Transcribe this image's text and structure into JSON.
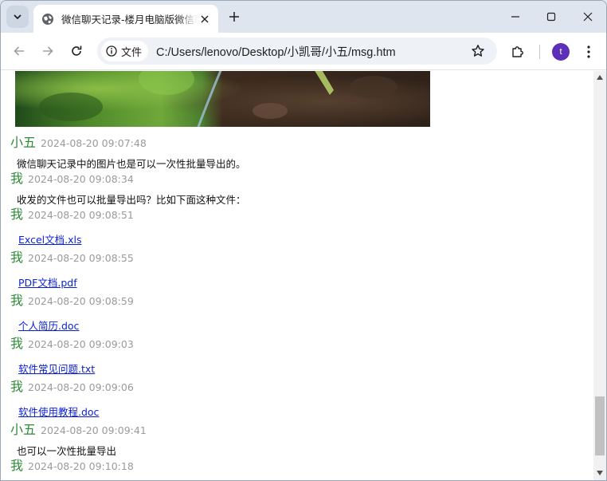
{
  "browser": {
    "tab_title": "微信聊天记录-楼月电脑版微信聊天记录导出",
    "address_chip_label": "文件",
    "url": "C:/Users/lenovo/Desktop/小凯哥/小五/msg.htm",
    "profile_initial": "t",
    "accent_color": "#5b2fb8"
  },
  "icons": {
    "tab_search": "chevron-down-icon",
    "favicon": "globe-icon",
    "tab_close": "close-icon",
    "new_tab": "plus-icon",
    "minimize": "minimize-icon",
    "maximize": "maximize-icon",
    "close_window": "close-icon",
    "back": "arrow-left-icon",
    "forward": "arrow-right-icon",
    "reload": "reload-icon",
    "info": "info-icon",
    "bookmark": "star-icon",
    "extensions": "puzzle-icon",
    "menu": "more-vertical-icon"
  },
  "messages": [
    {
      "sender": "小五",
      "time": "2024-08-20 09:07:48",
      "text": "微信聊天记录中的图片也是可以一次性批量导出的。"
    },
    {
      "sender": "我",
      "time": "2024-08-20 09:08:34",
      "text": "收发的文件也可以批量导出吗？比如下面这种文件："
    },
    {
      "sender": "我",
      "time": "2024-08-20 09:08:51",
      "link": "Excel文档.xls"
    },
    {
      "sender": "我",
      "time": "2024-08-20 09:08:55",
      "link": "PDF文档.pdf"
    },
    {
      "sender": "我",
      "time": "2024-08-20 09:08:59",
      "link": "个人简历.doc"
    },
    {
      "sender": "我",
      "time": "2024-08-20 09:09:03",
      "link": "软件常见问题.txt"
    },
    {
      "sender": "我",
      "time": "2024-08-20 09:09:06",
      "link": "软件使用教程.doc"
    },
    {
      "sender": "小五",
      "time": "2024-08-20 09:09:41",
      "text": "也可以一次性批量导出"
    },
    {
      "sender": "我",
      "time": "2024-08-20 09:10:18"
    }
  ],
  "colors": {
    "sender": "#2e8b3a",
    "timestamp": "#9a9a9a",
    "link": "#0a1fd6"
  }
}
